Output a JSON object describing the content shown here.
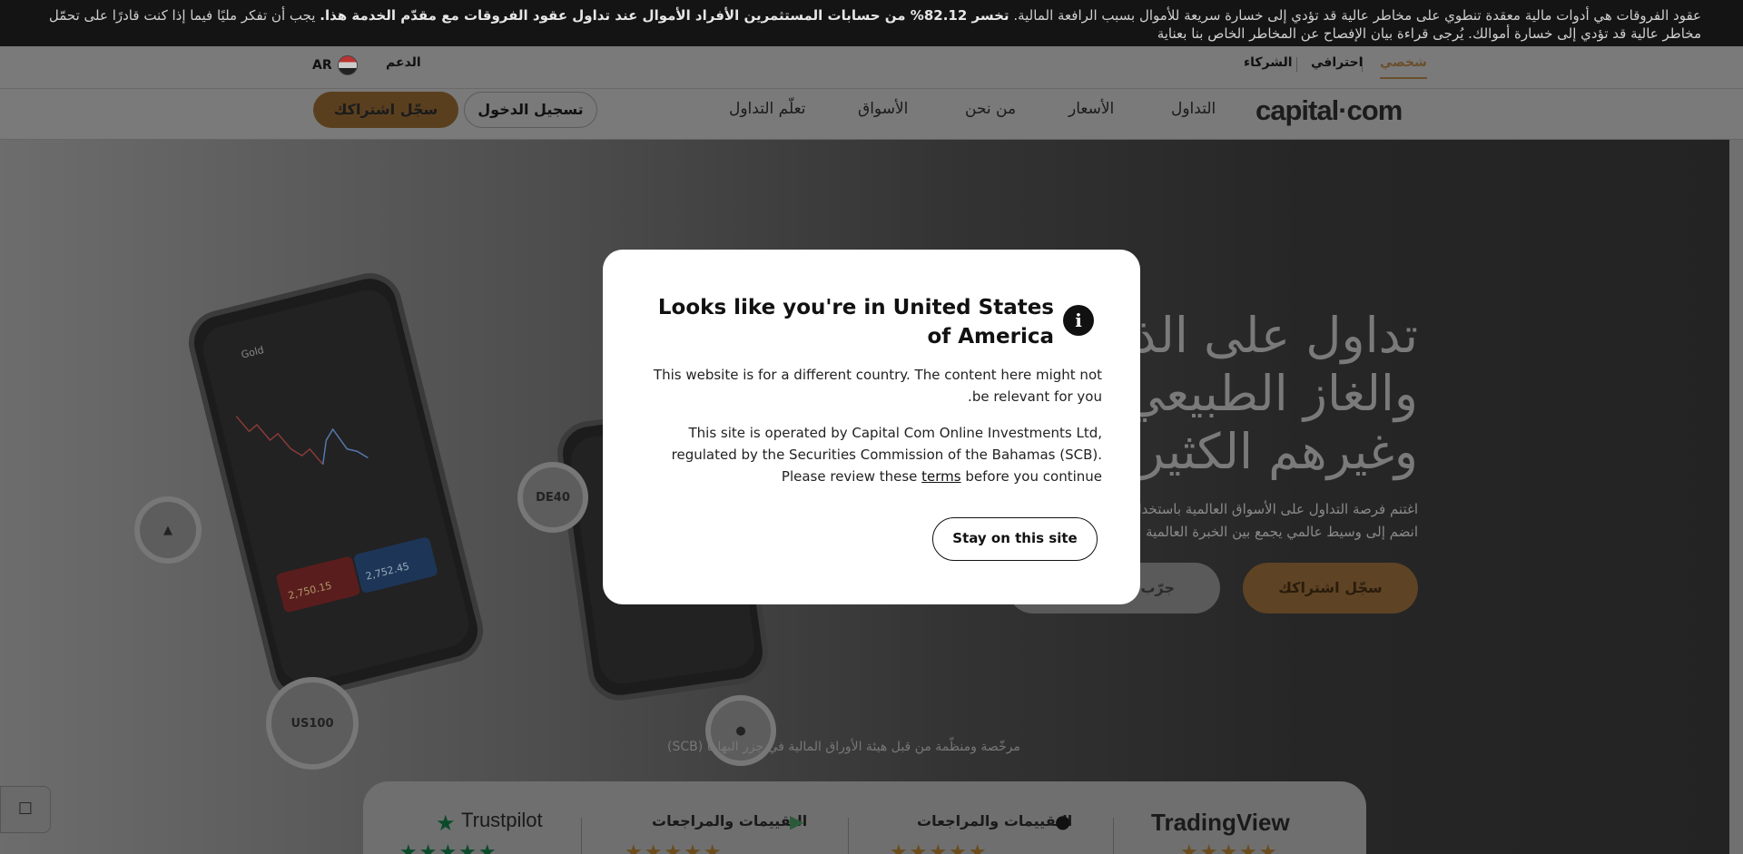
{
  "risk_banner": {
    "part1": "عقود الفروقات هي أدوات مالية معقدة تنطوي على مخاطر عالية قد تؤدي إلى خسارة سريعة للأموال بسبب الرافعة المالية.",
    "bold": "تخسر 82.12% من حسابات المستثمرين الأفراد الأموال عند تداول عقود الفروقات مع مقدّم الخدمة هذا.",
    "part2": "يجب أن تفكر مليًا فيما إذا كنت قادرًا على تحمّل مخاطر عالية قد تؤدي إلى خسارة أموالك. يُرجى قراءة بيان الإفصاح عن المخاطر الخاص بنا بعناية"
  },
  "utilbar": {
    "personal": "شخصي",
    "professional": "احترافي",
    "partners": "الشركاء",
    "support": "الدعم",
    "lang": "AR"
  },
  "nav": {
    "logo": "capital·com",
    "trading": "التداول",
    "prices": "الأسعار",
    "about": "من نحن",
    "markets": "الأسواق",
    "learn": "تعلّم التداول",
    "login": "تسجيل الدخول",
    "signup": "سجّل اشتراكك"
  },
  "hero": {
    "title_line1": "تداول على الذهب",
    "title_line2": "والغاز الطبيعي",
    "title_line3": "وغيرهم الكثير",
    "sub_line1": "اغتنم فرصة التداول على الأسواق العالمية باستخدام",
    "sub_line2": "انضم إلى وسيط عالمي يجمع بين الخبرة العالمية",
    "signup": "سجّل اشتراكك",
    "try": "جرّب",
    "regulated": "مرخّصة ومنظّمة من قبل هيئة الأوراق المالية في جزر البهاما (SCB)",
    "phone1_asset": "Gold",
    "sell_value": "2,750.15",
    "buy_value": "2,752.45",
    "coins": {
      "de40": "DE40",
      "us100": "US100"
    }
  },
  "ratings": {
    "tradingview": "TradingView",
    "apple": "التقييمات والمراجعات",
    "google": "التقييمات والمراجعات",
    "trustpilot": "Trustpilot",
    "stars": "★★★★★"
  },
  "modal": {
    "title": "Looks like you're in United States of America",
    "p1": "This website is for a different country. The content here might not be relevant for you.",
    "p2_before": "This site is operated by Capital Com Online Investments Ltd, regulated by the Securities Commission of the Bahamas (SCB). Please review these ",
    "terms": "terms",
    "p2_after": " before you continue",
    "stay": "Stay on this site"
  },
  "colors": {
    "accent": "#a87a3f",
    "overlay": "rgba(0,0,0,0.55)"
  }
}
